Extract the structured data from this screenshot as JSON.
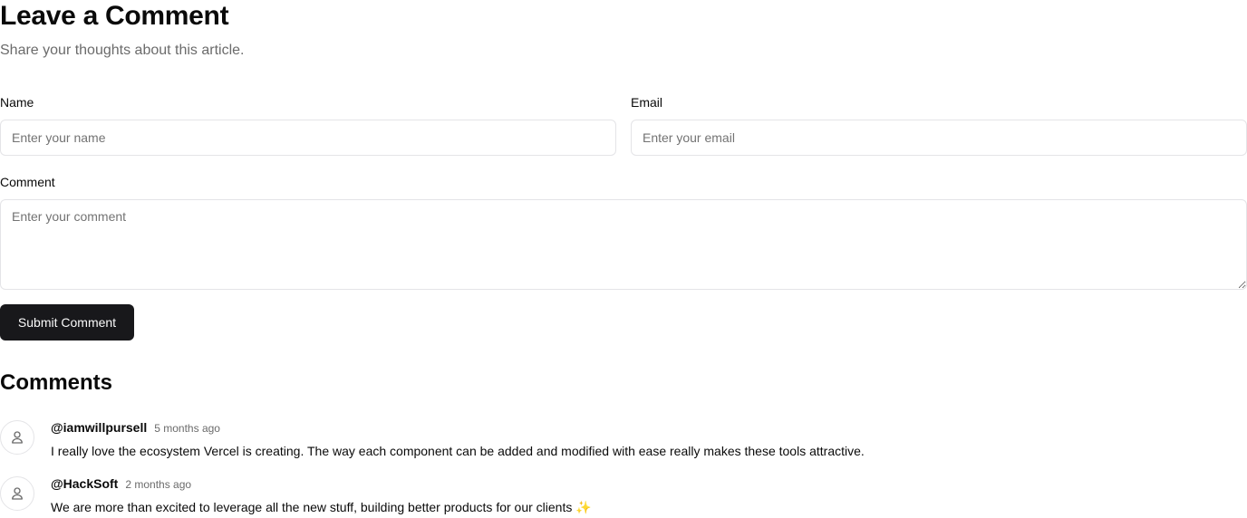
{
  "form": {
    "title": "Leave a Comment",
    "subtitle": "Share your thoughts about this article.",
    "name_label": "Name",
    "name_placeholder": "Enter your name",
    "email_label": "Email",
    "email_placeholder": "Enter your email",
    "comment_label": "Comment",
    "comment_placeholder": "Enter your comment",
    "submit_label": "Submit Comment"
  },
  "comments_section": {
    "title": "Comments",
    "items": [
      {
        "username": "@iamwillpursell",
        "time": "5 months ago",
        "text": "I really love the ecosystem Vercel is creating. The way each component can be added and modified with ease really makes these tools attractive.",
        "avatar_icon": "user-icon"
      },
      {
        "username": "@HackSoft",
        "time": "2 months ago",
        "text": "We are more than excited to leverage all the new stuff, building better products for our clients ✨",
        "avatar_icon": "user-icon"
      }
    ]
  },
  "colors": {
    "primary_button": "#18181b",
    "muted_text": "#6b6b6b",
    "border": "#e4e4e7"
  }
}
